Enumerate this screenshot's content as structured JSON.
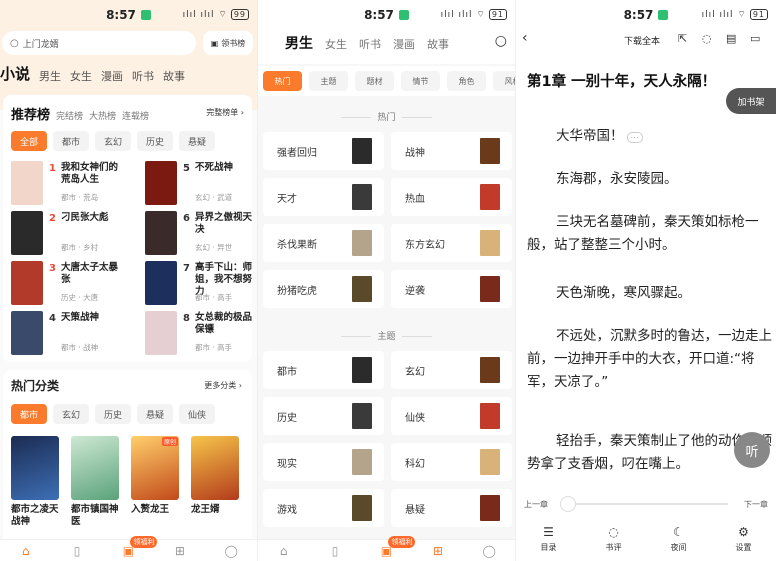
{
  "status": {
    "time": "8:57",
    "signal": "ılıl ılıl ⌔",
    "battery_left": "99",
    "battery_mid": "91",
    "battery_right": "91"
  },
  "panel1": {
    "search_placeholder": "上门龙婿",
    "shelf_button": "领书榜",
    "nav": [
      "小说",
      "男生",
      "女生",
      "漫画",
      "听书",
      "故事"
    ],
    "rank_header": {
      "title": "推荐榜",
      "tabs": [
        "完结榜",
        "大热榜",
        "连载榜"
      ],
      "full": "完整榜单 ›"
    },
    "rank_chips": [
      "全部",
      "都市",
      "玄幻",
      "历史",
      "悬疑"
    ],
    "ranks": [
      {
        "num": "1",
        "title": "我和女神们的荒岛人生",
        "sub": "都市 · 荒岛",
        "color": "#e94b3c"
      },
      {
        "num": "2",
        "title": "刁民张大彪",
        "sub": "都市 · 乡村",
        "color": "#e94b3c"
      },
      {
        "num": "3",
        "title": "大唐太子太暴张",
        "sub": "历史 · 大唐",
        "color": "#e94b3c"
      },
      {
        "num": "4",
        "title": "天策战神",
        "sub": "都市 · 战神",
        "color": "#333333"
      },
      {
        "num": "5",
        "title": "不死战神",
        "sub": "玄幻 · 武道",
        "color": "#333333"
      },
      {
        "num": "6",
        "title": "异界之傲视天决",
        "sub": "玄幻 · 异世",
        "color": "#333333"
      },
      {
        "num": "7",
        "title": "高手下山：师姐，我不想努力",
        "sub": "都市 · 高手",
        "color": "#333333"
      },
      {
        "num": "8",
        "title": "女总裁的极品保镖",
        "sub": "都市 · 高手",
        "color": "#333333"
      }
    ],
    "hot_header": {
      "title": "热门分类",
      "more": "更多分类 ›"
    },
    "hot_chips": [
      "都市",
      "玄幻",
      "历史",
      "悬疑",
      "仙侠"
    ],
    "books": [
      {
        "title": "都市之凌天战神",
        "badge": ""
      },
      {
        "title": "都市镇国神医",
        "badge": ""
      },
      {
        "title": "入赘龙王",
        "badge": "原创"
      },
      {
        "title": "龙王婿",
        "badge": ""
      }
    ],
    "tab_badge": "领福利"
  },
  "panel2": {
    "gender_tabs": [
      "男生",
      "女生",
      "听书",
      "漫画",
      "故事"
    ],
    "filter_chips": [
      "热门",
      "主题",
      "题材",
      "情节",
      "角色",
      "风格"
    ],
    "section1": "热门",
    "hot_genres": [
      "强者回归",
      "战神",
      "天才",
      "热血",
      "杀伐果断",
      "东方玄幻",
      "扮猪吃虎",
      "逆袭"
    ],
    "section2": "主题",
    "theme_genres": [
      "都市",
      "玄幻",
      "历史",
      "仙侠",
      "现实",
      "科幻",
      "游戏",
      "悬疑"
    ],
    "tab_badge": "领福利"
  },
  "panel3": {
    "download_all": "下载全本",
    "chapter_title": "第1章 一别十年，天人永隔！",
    "add_shelf": "加书架",
    "paragraphs": [
      "大华帝国！",
      "东海郡，永安陵园。",
      "三块无名墓碑前，秦天策如标枪一般，站了整整三个小时。",
      "天色渐晚，寒风骤起。",
      "不远处，沉默多时的鲁达，一边走上前，一边抻开手中的大衣，开口道:“将军，天凉了。”",
      "轻抬手，秦天策制止了他的动作，顺势拿了支香烟，叼在嘴上。"
    ],
    "listen": "听",
    "prev": "上一章",
    "next": "下一章",
    "tabs": [
      "目录",
      "书评",
      "夜间",
      "设置"
    ]
  }
}
